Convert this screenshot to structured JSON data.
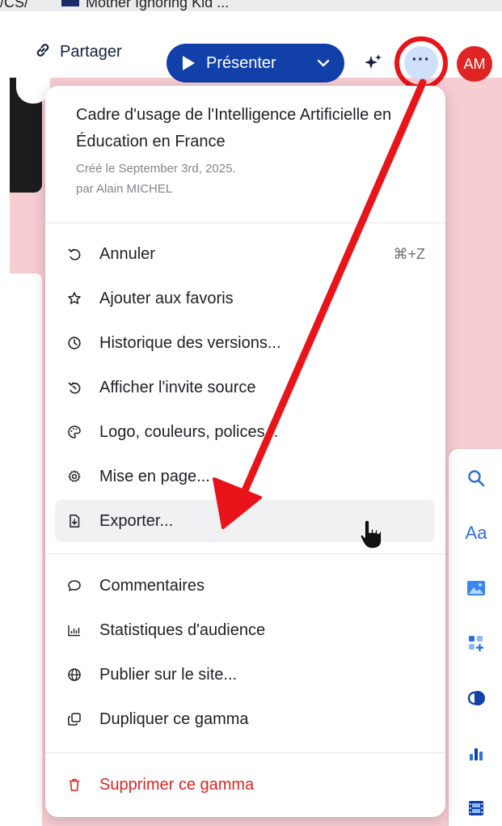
{
  "browser_tab": {
    "partial_text": "/CS/",
    "title": "Mother Ignoring Kid ..."
  },
  "topbar": {
    "share_label": "Partager",
    "present_label": "Présenter",
    "more_label": "···",
    "avatar_initials": "AM"
  },
  "menu": {
    "doc_title": "Cadre d'usage de l'Intelligence Artificielle en Éducation en France",
    "created": "Créé le September 3rd, 2025.",
    "author": "par Alain MICHEL",
    "groups": [
      [
        {
          "label": "Annuler",
          "icon": "undo-icon",
          "shortcut": "⌘+Z"
        },
        {
          "label": "Ajouter aux favoris",
          "icon": "star-icon"
        },
        {
          "label": "Historique des versions...",
          "icon": "clock-icon"
        },
        {
          "label": "Afficher l'invite source",
          "icon": "source-prompt-icon"
        },
        {
          "label": "Logo, couleurs, polices...",
          "icon": "palette-icon"
        },
        {
          "label": "Mise en page...",
          "icon": "gear-icon"
        },
        {
          "label": "Exporter...",
          "icon": "export-file-icon",
          "hovered": true
        }
      ],
      [
        {
          "label": "Commentaires",
          "icon": "comment-icon"
        },
        {
          "label": "Statistiques d'audience",
          "icon": "bar-chart-icon"
        },
        {
          "label": "Publier sur le site...",
          "icon": "globe-icon"
        },
        {
          "label": "Dupliquer ce gamma",
          "icon": "duplicate-icon"
        }
      ],
      [
        {
          "label": "Supprimer ce gamma",
          "icon": "trash-icon",
          "danger": true
        }
      ]
    ]
  },
  "right_toolbar": {
    "icons": [
      "search-icon",
      "text-style-icon",
      "image-icon",
      "add-block-icon",
      "toggle-theme-icon",
      "chart-icon",
      "film-icon"
    ],
    "text_style_glyph": "Aa"
  },
  "colors": {
    "primary": "#1140a9",
    "annotation_red": "#e8141a",
    "danger": "#e02424",
    "background_pink": "#f6cdd2",
    "more_button_bg": "#cfe0fb",
    "toolbar_icon_blue": "#2c6fd9"
  }
}
